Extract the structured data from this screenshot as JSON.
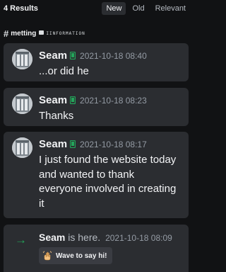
{
  "header": {
    "results_count": "4 Results",
    "sort_options": [
      "New",
      "Old",
      "Relevant"
    ],
    "active_sort": "New"
  },
  "channel": {
    "hash": "#",
    "name": "metting",
    "category": "IINFORMATION"
  },
  "messages": [
    {
      "user": "Seam",
      "time": "2021-10-18 08:40",
      "text": "...or did he"
    },
    {
      "user": "Seam",
      "time": "2021-10-18 08:23",
      "text": "Thanks"
    },
    {
      "user": "Seam",
      "time": "2021-10-18 08:17",
      "text": "I just found the website today and wanted to thank everyone involved in creating it"
    }
  ],
  "join": {
    "arrow": "→",
    "user": "Seam",
    "action": "is here.",
    "time": "2021-10-18 08:09",
    "wave_label": "Wave to say hi!"
  },
  "colors": {
    "background": "#111214",
    "card": "#2b2d31",
    "mobile_icon": "#23a55a",
    "arrow": "#23a55a"
  }
}
